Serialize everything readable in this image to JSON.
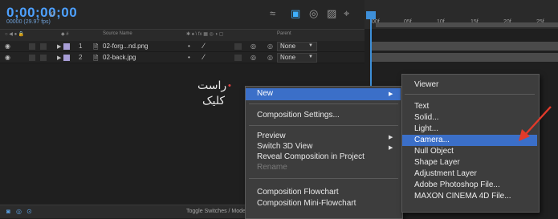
{
  "header": {
    "timecode": "0;00;00;00",
    "fps": "00000 (29.97 fps)",
    "search_icon": "search-icon"
  },
  "column_headers": {
    "source_name": "Source Name",
    "parent": "Parent"
  },
  "layers": [
    {
      "number": "1",
      "name": "02-forg...nd.png",
      "parent": "None"
    },
    {
      "number": "2",
      "name": "02-back.jpg",
      "parent": "None"
    }
  ],
  "timeline": {
    "ticks": [
      "00f",
      "05f",
      "10f",
      "15f",
      "20f",
      "25f"
    ]
  },
  "bottom_bar": {
    "toggle_label": "Toggle Switches / Modes"
  },
  "annotation": {
    "line1": "راست",
    "line2": "کلیک"
  },
  "context_menu": {
    "new": "New",
    "composition_settings": "Composition Settings...",
    "preview": "Preview",
    "switch_3d_view": "Switch 3D View",
    "reveal_composition": "Reveal Composition in Project",
    "rename": "Rename",
    "composition_flowchart": "Composition Flowchart",
    "composition_mini_flowchart": "Composition Mini-Flowchart"
  },
  "submenu": {
    "viewer": "Viewer",
    "text": "Text",
    "solid": "Solid...",
    "light": "Light...",
    "camera": "Camera...",
    "null_object": "Null Object",
    "shape_layer": "Shape Layer",
    "adjustment_layer": "Adjustment Layer",
    "adobe_photoshop_file": "Adobe Photoshop File...",
    "maxon_cinema4d_file": "MAXON CINEMA 4D File..."
  },
  "colors": {
    "highlight": "#3b6fc8",
    "timecode": "#4da0ff",
    "annotation_arrow": "#e23a2a",
    "label_color": "#a89ed6"
  }
}
